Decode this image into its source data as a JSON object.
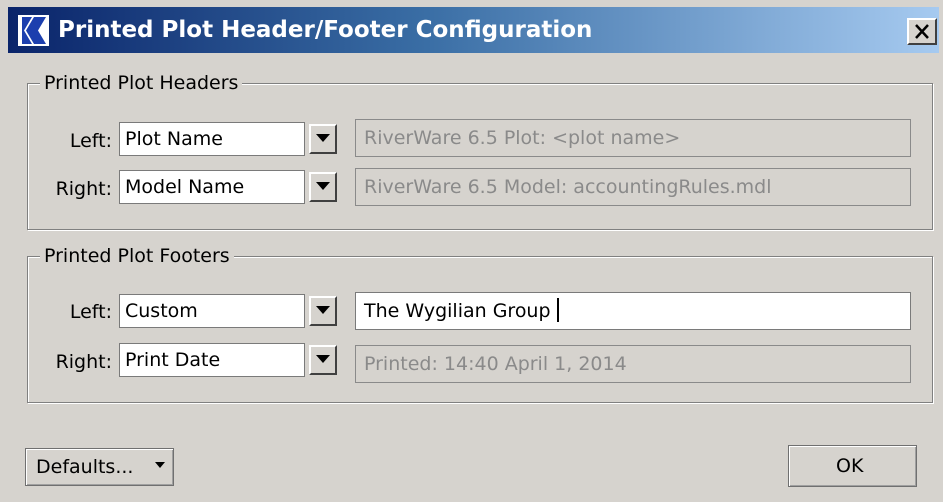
{
  "window": {
    "title": "Printed Plot Header/Footer Configuration",
    "close_glyph": "X",
    "app_icon": "riverware-logo-icon"
  },
  "headers": {
    "legend": "Printed Plot Headers",
    "left": {
      "label": "Left:",
      "selected": "Plot Name",
      "text": "RiverWare 6.5 Plot: <plot name>",
      "editable": false
    },
    "right": {
      "label": "Right:",
      "selected": "Model Name",
      "text": "RiverWare 6.5 Model: accountingRules.mdl",
      "editable": false
    }
  },
  "footers": {
    "legend": "Printed Plot Footers",
    "left": {
      "label": "Left:",
      "selected": "Custom",
      "text": "The Wygilian Group",
      "editable": true
    },
    "right": {
      "label": "Right:",
      "selected": "Print Date",
      "text": "Printed: 14:40 April 1, 2014",
      "editable": false
    }
  },
  "buttons": {
    "defaults_label": "Defaults...",
    "ok_label": "OK"
  },
  "colors": {
    "title_start": "#0a246a",
    "title_end": "#a6caf0",
    "window_bg": "#d6d3ce",
    "disabled_text": "#8a8a8a"
  }
}
